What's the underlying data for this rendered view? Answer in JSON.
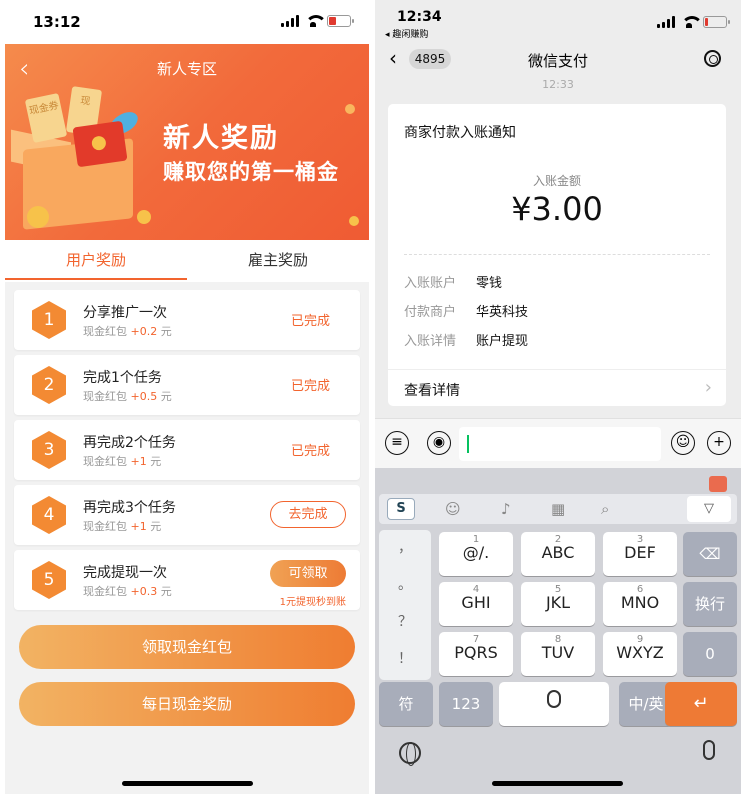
{
  "left": {
    "status_time": "13:12",
    "nav_title": "新人专区",
    "banner": {
      "line1": "新人奖励",
      "line2": "赚取您的第一桶金",
      "deco_note1": "现金券",
      "deco_note2": "现"
    },
    "tabs": [
      "用户奖励",
      "雇主奖励"
    ],
    "tasks": [
      {
        "num": "1",
        "name": "分享推广一次",
        "sub": "现金红包",
        "reward": "+0.2",
        "unit": "元",
        "status": "已完成"
      },
      {
        "num": "2",
        "name": "完成1个任务",
        "sub": "现金红包",
        "reward": "+0.5",
        "unit": "元",
        "status": "已完成"
      },
      {
        "num": "3",
        "name": "再完成2个任务",
        "sub": "现金红包",
        "reward": "+1",
        "unit": "元",
        "status": "已完成"
      },
      {
        "num": "4",
        "name": "再完成3个任务",
        "sub": "现金红包",
        "reward": "+1",
        "unit": "元",
        "status": "去完成"
      },
      {
        "num": "5",
        "name": "完成提现一次",
        "sub": "现金红包",
        "reward": "+0.3",
        "unit": "元",
        "status": "可领取",
        "note": "1元提现秒到账"
      }
    ],
    "buttons": [
      "领取现金红包",
      "每日现金奖励"
    ]
  },
  "right": {
    "status_time": "12:34",
    "status_sub": "◂ 趣闲赚购",
    "back_count": "4895",
    "title": "微信支付",
    "msg_time": "12:33",
    "card": {
      "title": "商家付款入账通知",
      "amount_label": "入账金额",
      "amount": "¥3.00",
      "rows": [
        {
          "k": "入账账户",
          "v": "零钱"
        },
        {
          "k": "付款商户",
          "v": "华英科技"
        },
        {
          "k": "入账详情",
          "v": "账户提现"
        }
      ],
      "more": "查看详情"
    },
    "keyboard": {
      "punct": [
        "，",
        "。",
        "？",
        "！"
      ],
      "keys": [
        {
          "n": "1",
          "l": "@/."
        },
        {
          "n": "2",
          "l": "ABC"
        },
        {
          "n": "3",
          "l": "DEF"
        },
        {
          "n": "4",
          "l": "GHI"
        },
        {
          "n": "5",
          "l": "JKL"
        },
        {
          "n": "6",
          "l": "MNO"
        },
        {
          "n": "7",
          "l": "PQRS"
        },
        {
          "n": "8",
          "l": "TUV"
        },
        {
          "n": "9",
          "l": "WXYZ"
        }
      ],
      "delete": "⌫",
      "newline": "换行",
      "zero": "0",
      "symbol": "符",
      "num123": "123",
      "lang": "中/英",
      "enter": "↵",
      "logo": "S"
    }
  }
}
